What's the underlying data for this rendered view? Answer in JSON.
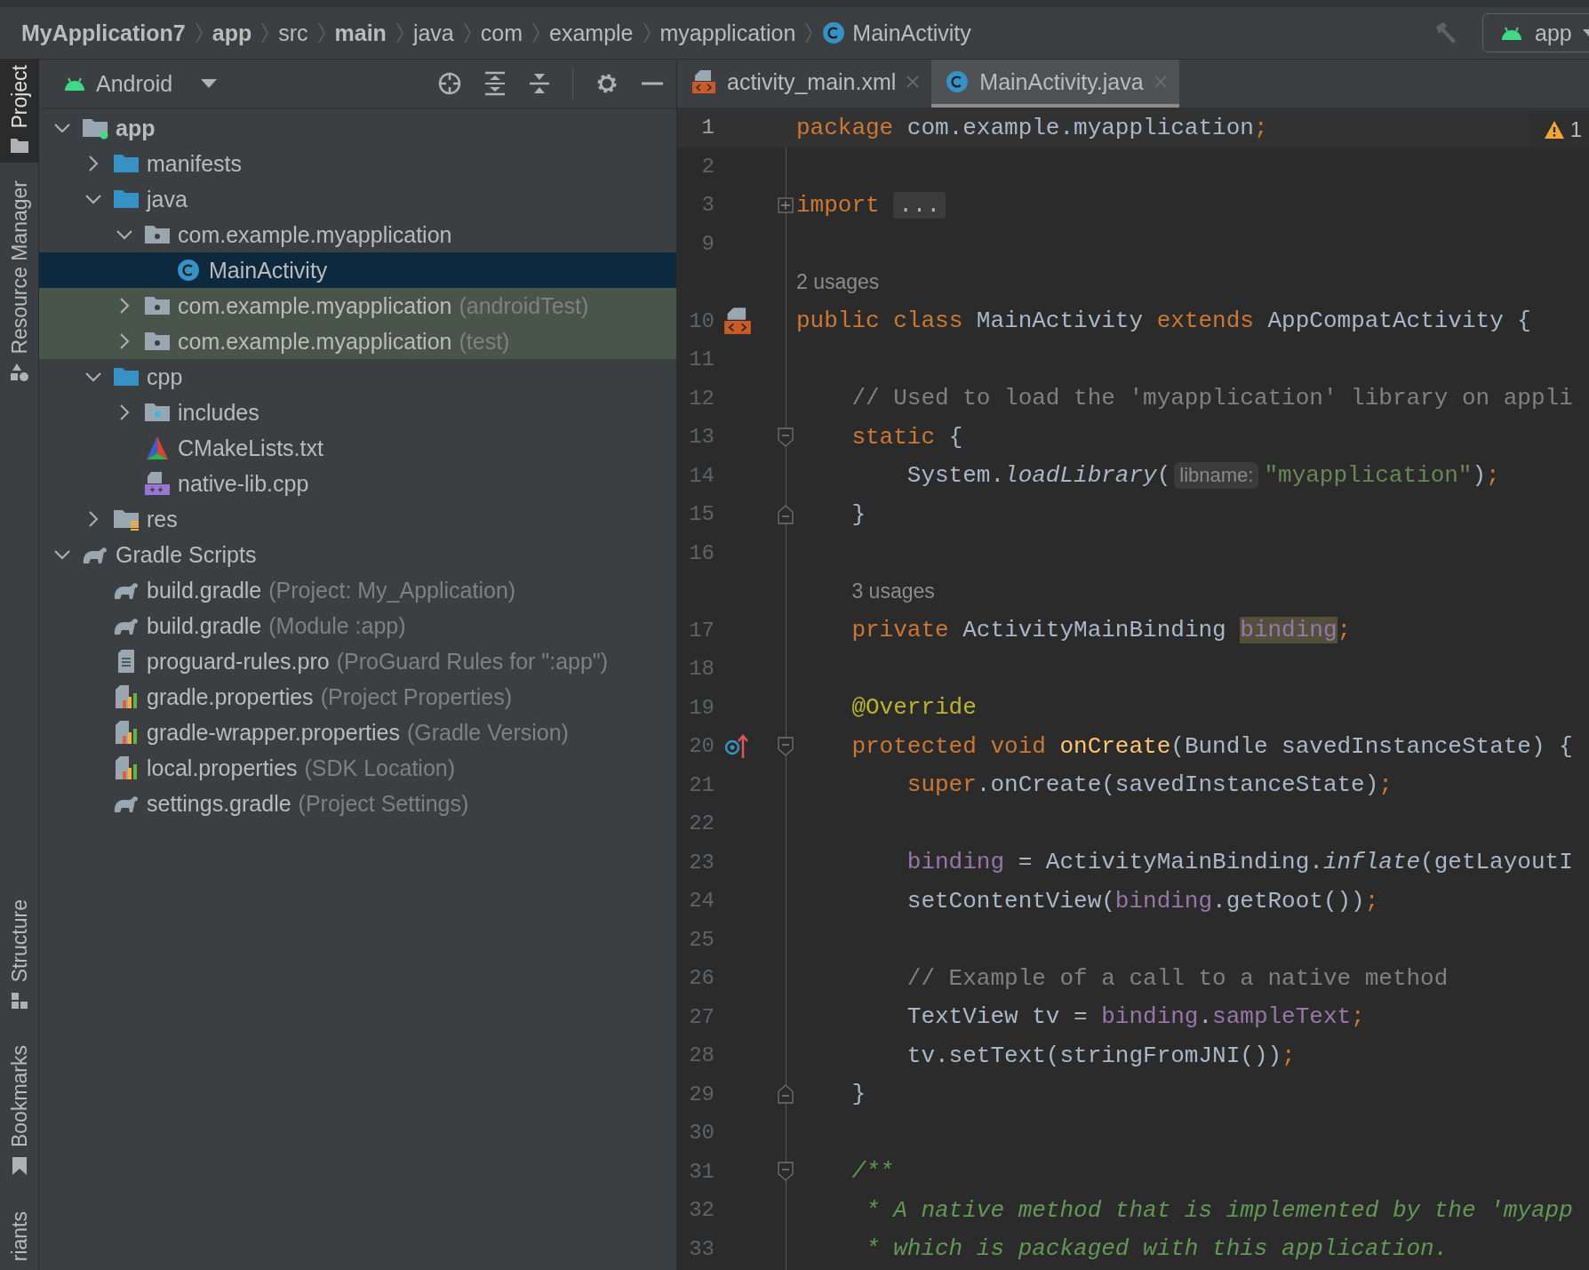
{
  "breadcrumbs": [
    {
      "label": "MyApplication7",
      "bold": true,
      "kind": "folder"
    },
    {
      "label": "app",
      "bold": true,
      "kind": "folder"
    },
    {
      "label": "src",
      "bold": false,
      "kind": "folder"
    },
    {
      "label": "main",
      "bold": true,
      "kind": "folder"
    },
    {
      "label": "java",
      "bold": false,
      "kind": "folder"
    },
    {
      "label": "com",
      "bold": false,
      "kind": "folder"
    },
    {
      "label": "example",
      "bold": false,
      "kind": "folder"
    },
    {
      "label": "myapplication",
      "bold": false,
      "kind": "folder"
    },
    {
      "label": "MainActivity",
      "bold": false,
      "kind": "class"
    }
  ],
  "run_config": {
    "label": "app"
  },
  "tool_stripe": [
    {
      "label": "Project",
      "selected": true,
      "kind": "folder"
    },
    {
      "label": "Resource Manager",
      "selected": false,
      "kind": "shapes"
    },
    {
      "label": "Structure",
      "selected": false,
      "kind": "structure"
    },
    {
      "label": "Bookmarks",
      "selected": false,
      "kind": "bookmark"
    },
    {
      "label": "riants",
      "selected": false,
      "kind": "plain"
    }
  ],
  "project_panel": {
    "view": "Android",
    "tree": [
      {
        "label": "app",
        "kind": "module",
        "expanded": true,
        "selected": false,
        "test_source": false,
        "children": [
          {
            "label": "manifests",
            "kind": "folder",
            "expanded": false,
            "selected": false,
            "test_source": false
          },
          {
            "label": "java",
            "kind": "folder",
            "expanded": true,
            "selected": false,
            "test_source": false,
            "children": [
              {
                "label": "com.example.myapplication",
                "kind": "package",
                "expanded": true,
                "selected": false,
                "test_source": false,
                "children": [
                  {
                    "label": "MainActivity",
                    "kind": "class",
                    "selected": true,
                    "test_source": false
                  }
                ]
              },
              {
                "label": "com.example.myapplication",
                "suffix": "(androidTest)",
                "kind": "package",
                "expanded": false,
                "selected": false,
                "test_source": true
              },
              {
                "label": "com.example.myapplication",
                "suffix": "(test)",
                "kind": "package",
                "expanded": false,
                "selected": false,
                "test_source": true
              }
            ]
          },
          {
            "label": "cpp",
            "kind": "folder",
            "expanded": true,
            "selected": false,
            "test_source": false,
            "children": [
              {
                "label": "includes",
                "kind": "include",
                "expanded": false,
                "selected": false,
                "test_source": false
              },
              {
                "label": "CMakeLists.txt",
                "kind": "cmake",
                "selected": false,
                "test_source": false
              },
              {
                "label": "native-lib.cpp",
                "kind": "cpp",
                "selected": false,
                "test_source": false
              }
            ]
          },
          {
            "label": "res",
            "kind": "res",
            "expanded": false,
            "selected": false,
            "test_source": false
          }
        ]
      },
      {
        "label": "Gradle Scripts",
        "kind": "gradle",
        "expanded": true,
        "selected": false,
        "test_source": false,
        "children": [
          {
            "label": "build.gradle",
            "suffix": "(Project: My_Application)",
            "kind": "gradle",
            "selected": false,
            "test_source": false
          },
          {
            "label": "build.gradle",
            "suffix": "(Module :app)",
            "kind": "gradle",
            "selected": false,
            "test_source": false
          },
          {
            "label": "proguard-rules.pro",
            "suffix": "(ProGuard Rules for \":app\")",
            "kind": "text",
            "selected": false,
            "test_source": false
          },
          {
            "label": "gradle.properties",
            "suffix": "(Project Properties)",
            "kind": "properties",
            "selected": false,
            "test_source": false
          },
          {
            "label": "gradle-wrapper.properties",
            "suffix": "(Gradle Version)",
            "kind": "properties",
            "selected": false,
            "test_source": false
          },
          {
            "label": "local.properties",
            "suffix": "(SDK Location)",
            "kind": "properties",
            "selected": false,
            "test_source": false
          },
          {
            "label": "settings.gradle",
            "suffix": "(Project Settings)",
            "kind": "gradle",
            "selected": false,
            "test_source": false
          }
        ]
      }
    ]
  },
  "editor": {
    "tabs": [
      {
        "label": "activity_main.xml",
        "kind": "layout",
        "selected": false
      },
      {
        "label": "MainActivity.java",
        "kind": "class",
        "selected": true
      }
    ],
    "inspection": {
      "count": "1"
    },
    "lines": [
      {
        "kind": "code",
        "number": "1",
        "current": true,
        "tokens": [
          {
            "text": "package",
            "kind": "kw"
          },
          {
            "text": " com.example.myapplication",
            "kind": "plain"
          },
          {
            "text": ";",
            "kind": "punct"
          }
        ]
      },
      {
        "kind": "code",
        "number": "2",
        "current": false
      },
      {
        "kind": "code",
        "number": "3",
        "current": false,
        "fold": {
          "kind": "collapsed"
        },
        "tokens": [
          {
            "text": "import ",
            "kind": "kw"
          },
          {
            "text": "...",
            "kind": "folded"
          }
        ]
      },
      {
        "kind": "code",
        "number": "9",
        "current": false
      },
      {
        "kind": "usages",
        "text": "2 usages"
      },
      {
        "kind": "code",
        "number": "10",
        "current": false,
        "gutter": {
          "kind": "layout"
        },
        "tokens": [
          {
            "text": "public class ",
            "kind": "kw"
          },
          {
            "text": "MainActivity ",
            "kind": "plain"
          },
          {
            "text": "extends ",
            "kind": "kw"
          },
          {
            "text": "AppCompatActivity {",
            "kind": "plain"
          }
        ]
      },
      {
        "kind": "code",
        "number": "11",
        "current": false
      },
      {
        "kind": "code",
        "number": "12",
        "current": false,
        "tokens": [
          {
            "text": "    // Used to load the 'myapplication' library on appli",
            "kind": "comment"
          }
        ]
      },
      {
        "kind": "code",
        "number": "13",
        "current": false,
        "fold": {
          "kind": "start"
        },
        "tokens": [
          {
            "text": "    static ",
            "kind": "kw"
          },
          {
            "text": "{",
            "kind": "plain"
          }
        ]
      },
      {
        "kind": "code",
        "number": "14",
        "current": false,
        "tokens": [
          {
            "text": "        System.",
            "kind": "plain"
          },
          {
            "text": "loadLibrary",
            "kind": "static-call"
          },
          {
            "text": "(",
            "kind": "plain"
          },
          {
            "text": "libname:",
            "kind": "hint"
          },
          {
            "text": "\"myapplication\"",
            "kind": "string"
          },
          {
            "text": ")",
            "kind": "plain"
          },
          {
            "text": ";",
            "kind": "punct"
          }
        ]
      },
      {
        "kind": "code",
        "number": "15",
        "current": false,
        "fold": {
          "kind": "end"
        },
        "tokens": [
          {
            "text": "    }",
            "kind": "plain"
          }
        ]
      },
      {
        "kind": "code",
        "number": "16",
        "current": false
      },
      {
        "kind": "usages",
        "text": "3 usages"
      },
      {
        "kind": "code",
        "number": "17",
        "current": false,
        "tokens": [
          {
            "text": "    private ",
            "kind": "kw"
          },
          {
            "text": "ActivityMainBinding ",
            "kind": "plain"
          },
          {
            "text": "binding",
            "kind": "field-hl"
          },
          {
            "text": ";",
            "kind": "punct"
          }
        ]
      },
      {
        "kind": "code",
        "number": "18",
        "current": false
      },
      {
        "kind": "code",
        "number": "19",
        "current": false,
        "tokens": [
          {
            "text": "    @Override",
            "kind": "annotation"
          }
        ]
      },
      {
        "kind": "code",
        "number": "20",
        "current": false,
        "gutter": {
          "kind": "override"
        },
        "fold": {
          "kind": "start"
        },
        "tokens": [
          {
            "text": "    protected void ",
            "kind": "kw"
          },
          {
            "text": "onCreate",
            "kind": "method-decl"
          },
          {
            "text": "(Bundle savedInstanceState) {",
            "kind": "plain"
          }
        ]
      },
      {
        "kind": "code",
        "number": "21",
        "current": false,
        "tokens": [
          {
            "text": "        super",
            "kind": "kw"
          },
          {
            "text": ".onCreate(savedInstanceState)",
            "kind": "plain"
          },
          {
            "text": ";",
            "kind": "punct"
          }
        ]
      },
      {
        "kind": "code",
        "number": "22",
        "current": false
      },
      {
        "kind": "code",
        "number": "23",
        "current": false,
        "tokens": [
          {
            "text": "        binding",
            "kind": "field"
          },
          {
            "text": " = ActivityMainBinding.",
            "kind": "plain"
          },
          {
            "text": "inflate",
            "kind": "static-call"
          },
          {
            "text": "(getLayoutI",
            "kind": "plain"
          }
        ]
      },
      {
        "kind": "code",
        "number": "24",
        "current": false,
        "tokens": [
          {
            "text": "        setContentView(",
            "kind": "plain"
          },
          {
            "text": "binding",
            "kind": "field"
          },
          {
            "text": ".getRoot())",
            "kind": "plain"
          },
          {
            "text": ";",
            "kind": "punct"
          }
        ]
      },
      {
        "kind": "code",
        "number": "25",
        "current": false
      },
      {
        "kind": "code",
        "number": "26",
        "current": false,
        "tokens": [
          {
            "text": "        // Example of a call to a native method",
            "kind": "comment"
          }
        ]
      },
      {
        "kind": "code",
        "number": "27",
        "current": false,
        "tokens": [
          {
            "text": "        TextView tv = ",
            "kind": "plain"
          },
          {
            "text": "binding",
            "kind": "field"
          },
          {
            "text": ".",
            "kind": "plain"
          },
          {
            "text": "sampleText",
            "kind": "field"
          },
          {
            "text": ";",
            "kind": "punct"
          }
        ]
      },
      {
        "kind": "code",
        "number": "28",
        "current": false,
        "tokens": [
          {
            "text": "        tv.setText(stringFromJNI())",
            "kind": "plain"
          },
          {
            "text": ";",
            "kind": "punct"
          }
        ]
      },
      {
        "kind": "code",
        "number": "29",
        "current": false,
        "fold": {
          "kind": "end"
        },
        "tokens": [
          {
            "text": "    }",
            "kind": "plain"
          }
        ]
      },
      {
        "kind": "code",
        "number": "30",
        "current": false
      },
      {
        "kind": "code",
        "number": "31",
        "current": false,
        "fold": {
          "kind": "start"
        },
        "tokens": [
          {
            "text": "    /**",
            "kind": "doc"
          }
        ]
      },
      {
        "kind": "code",
        "number": "32",
        "current": false,
        "tokens": [
          {
            "text": "     * A native method that is implemented by the 'myapp",
            "kind": "doc"
          }
        ]
      },
      {
        "kind": "code",
        "number": "33",
        "current": false,
        "tokens": [
          {
            "text": "     * which is packaged with this application.",
            "kind": "doc"
          }
        ]
      }
    ]
  }
}
